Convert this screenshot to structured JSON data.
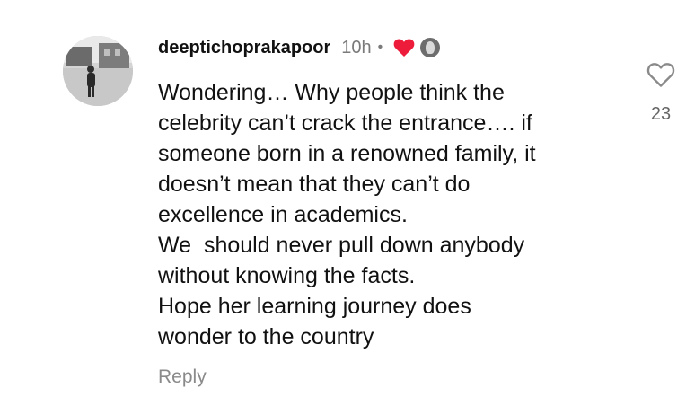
{
  "comment": {
    "username": "deeptichoprakapoor",
    "time": "10h",
    "separator": "•",
    "text_lines": [
      "Wondering… Why people think the",
      "celebrity can’t crack the entrance…. if",
      "someone born in a renowned family, it",
      "doesn’t mean that they can’t do",
      "excellence in academics.",
      "We  should never pull down anybody",
      "without knowing the facts.",
      "Hope her learning journey does",
      "wonder to the country"
    ],
    "reply_label": "Reply",
    "like_count": "23",
    "icons": {
      "author_like": "red-heart-icon",
      "author_avatar": "mini-avatar-icon",
      "like": "heart-outline-icon"
    },
    "colors": {
      "liked_heart": "#ed1c3a",
      "meta_text": "#7a7a7a",
      "text": "#111111"
    }
  }
}
